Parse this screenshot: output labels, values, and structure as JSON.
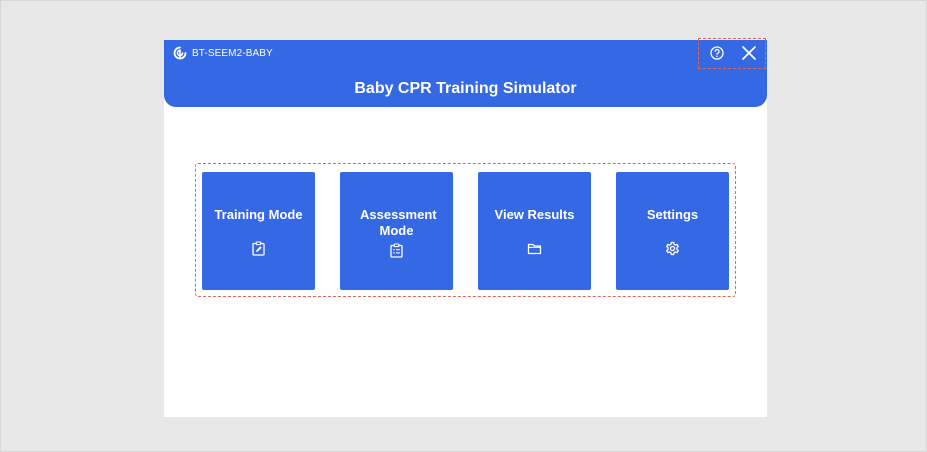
{
  "header": {
    "brand_name": "BT-SEEM2-BABY",
    "title": "Baby CPR Training Simulator",
    "brand_logo_icon": "brand-logo-icon",
    "help_icon": "help-circle-icon",
    "close_icon": "close-icon"
  },
  "modes": [
    {
      "label": "Training Mode",
      "icon": "clipboard-edit-icon"
    },
    {
      "label": "Assessment Mode",
      "icon": "clipboard-list-icon"
    },
    {
      "label": "View Results",
      "icon": "folder-icon"
    },
    {
      "label": "Settings",
      "icon": "gear-icon"
    }
  ],
  "colors": {
    "accent": "#3568e4",
    "highlight_dashed": "#d96a5a",
    "background": "#e8e8e8",
    "window": "#ffffff"
  }
}
